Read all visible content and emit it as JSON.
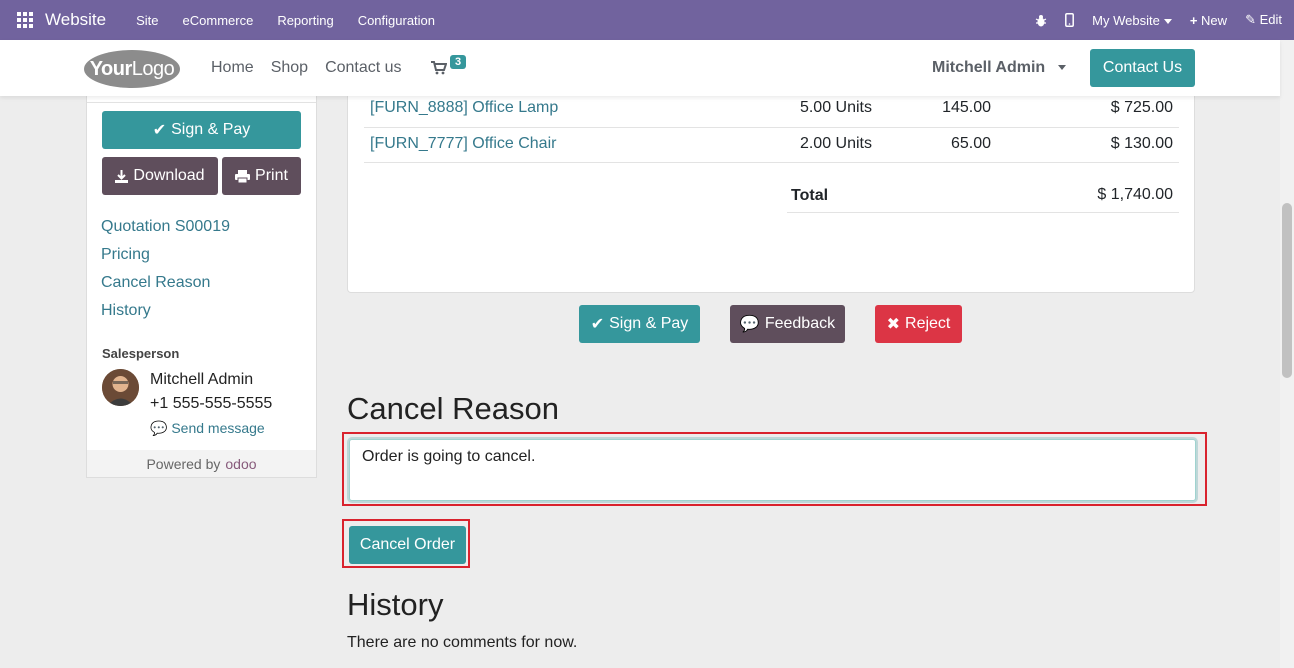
{
  "topbar": {
    "app_name": "Website",
    "menus": [
      "Site",
      "eCommerce",
      "Reporting",
      "Configuration"
    ],
    "my_website": "My Website",
    "new_label": "New",
    "edit_label": "Edit"
  },
  "header": {
    "logo_text_bold": "Your",
    "logo_text": "Logo",
    "nav": [
      "Home",
      "Shop",
      "Contact us"
    ],
    "cart_count": "3",
    "user": "Mitchell Admin",
    "contact_button": "Contact Us"
  },
  "sidebar": {
    "sign_pay": "Sign & Pay",
    "download": "Download",
    "print": "Print",
    "links": [
      "Quotation S00019",
      "Pricing",
      "Cancel Reason",
      "History"
    ],
    "salesperson_title": "Salesperson",
    "salesperson_name": "Mitchell Admin",
    "salesperson_phone": "+1 555-555-5555",
    "send_message": "Send message",
    "powered_by": "Powered by",
    "powered_brand": "odoo"
  },
  "order": {
    "lines": [
      {
        "product": "[FURN_8888] Office Lamp",
        "qty": "5.00 Units",
        "price": "145.00",
        "subtotal": "$ 725.00"
      },
      {
        "product": "[FURN_7777] Office Chair",
        "qty": "2.00 Units",
        "price": "65.00",
        "subtotal": "$ 130.00"
      }
    ],
    "total_label": "Total",
    "total_value": "$ 1,740.00"
  },
  "actions": {
    "sign_pay": "Sign & Pay",
    "feedback": "Feedback",
    "reject": "Reject"
  },
  "cancel": {
    "title": "Cancel Reason",
    "reason_value": "Order is going to cancel.",
    "button": "Cancel Order"
  },
  "history": {
    "title": "History",
    "empty": "There are no comments for now."
  },
  "colors": {
    "topbar": "#71639e",
    "primary": "#35979c",
    "secondary": "#5f4e5c",
    "danger": "#dc3545",
    "highlight": "#d9232e"
  }
}
